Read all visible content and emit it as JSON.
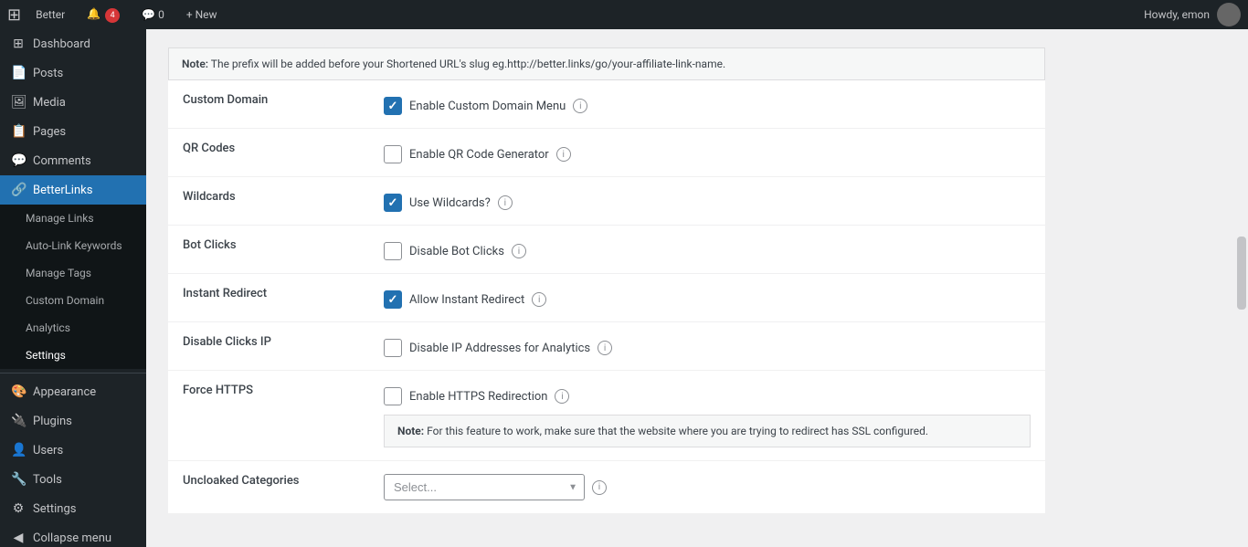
{
  "adminBar": {
    "wpLogo": "⊞",
    "siteName": "Better",
    "notifCount": "4",
    "commentCount": "0",
    "newLabel": "+ New",
    "howdy": "Howdy, emon"
  },
  "sidebar": {
    "items": [
      {
        "id": "dashboard",
        "label": "Dashboard",
        "icon": "⊞"
      },
      {
        "id": "posts",
        "label": "Posts",
        "icon": "📄"
      },
      {
        "id": "media",
        "label": "Media",
        "icon": "🖼"
      },
      {
        "id": "pages",
        "label": "Pages",
        "icon": "📋"
      },
      {
        "id": "comments",
        "label": "Comments",
        "icon": "💬"
      },
      {
        "id": "betterlinks",
        "label": "BetterLinks",
        "icon": "🔗",
        "active": true
      }
    ],
    "submenuItems": [
      {
        "id": "manage-links",
        "label": "Manage Links"
      },
      {
        "id": "auto-link-keywords",
        "label": "Auto-Link Keywords"
      },
      {
        "id": "manage-tags",
        "label": "Manage Tags"
      },
      {
        "id": "custom-domain",
        "label": "Custom Domain"
      },
      {
        "id": "analytics",
        "label": "Analytics"
      },
      {
        "id": "settings",
        "label": "Settings",
        "active": true
      }
    ],
    "bottomItems": [
      {
        "id": "appearance",
        "label": "Appearance",
        "icon": "🎨"
      },
      {
        "id": "plugins",
        "label": "Plugins",
        "icon": "🔌"
      },
      {
        "id": "users",
        "label": "Users",
        "icon": "👤"
      },
      {
        "id": "tools",
        "label": "Tools",
        "icon": "🔧"
      },
      {
        "id": "settings-wp",
        "label": "Settings",
        "icon": "⚙"
      },
      {
        "id": "collapse-menu",
        "label": "Collapse menu",
        "icon": "◀"
      }
    ]
  },
  "content": {
    "notePrefix": "Note:",
    "noteText": "The prefix will be added before your Shortened URL's slug eg.http://better.links/go/your-affiliate-link-name.",
    "rows": [
      {
        "id": "custom-domain",
        "label": "Custom Domain",
        "checkboxLabel": "Enable Custom Domain Menu",
        "checked": true,
        "hasInfo": true
      },
      {
        "id": "qr-codes",
        "label": "QR Codes",
        "checkboxLabel": "Enable QR Code Generator",
        "checked": false,
        "hasInfo": true
      },
      {
        "id": "wildcards",
        "label": "Wildcards",
        "checkboxLabel": "Use Wildcards?",
        "checked": true,
        "hasInfo": true
      },
      {
        "id": "bot-clicks",
        "label": "Bot Clicks",
        "checkboxLabel": "Disable Bot Clicks",
        "checked": false,
        "hasInfo": true
      },
      {
        "id": "instant-redirect",
        "label": "Instant Redirect",
        "checkboxLabel": "Allow Instant Redirect",
        "checked": true,
        "hasInfo": true
      },
      {
        "id": "disable-clicks-ip",
        "label": "Disable Clicks IP",
        "checkboxLabel": "Disable IP Addresses for Analytics",
        "checked": false,
        "hasInfo": true
      },
      {
        "id": "force-https",
        "label": "Force HTTPS",
        "checkboxLabel": "Enable HTTPS Redirection",
        "checked": false,
        "hasInfo": true,
        "hasNote": true,
        "notePrefix": "Note:",
        "noteText": "For this feature to work, make sure that the website where you are trying to redirect has SSL configured."
      }
    ],
    "uncloakedCategories": {
      "label": "Uncloaked Categories",
      "placeholder": "Select...",
      "hasInfo": true
    }
  }
}
